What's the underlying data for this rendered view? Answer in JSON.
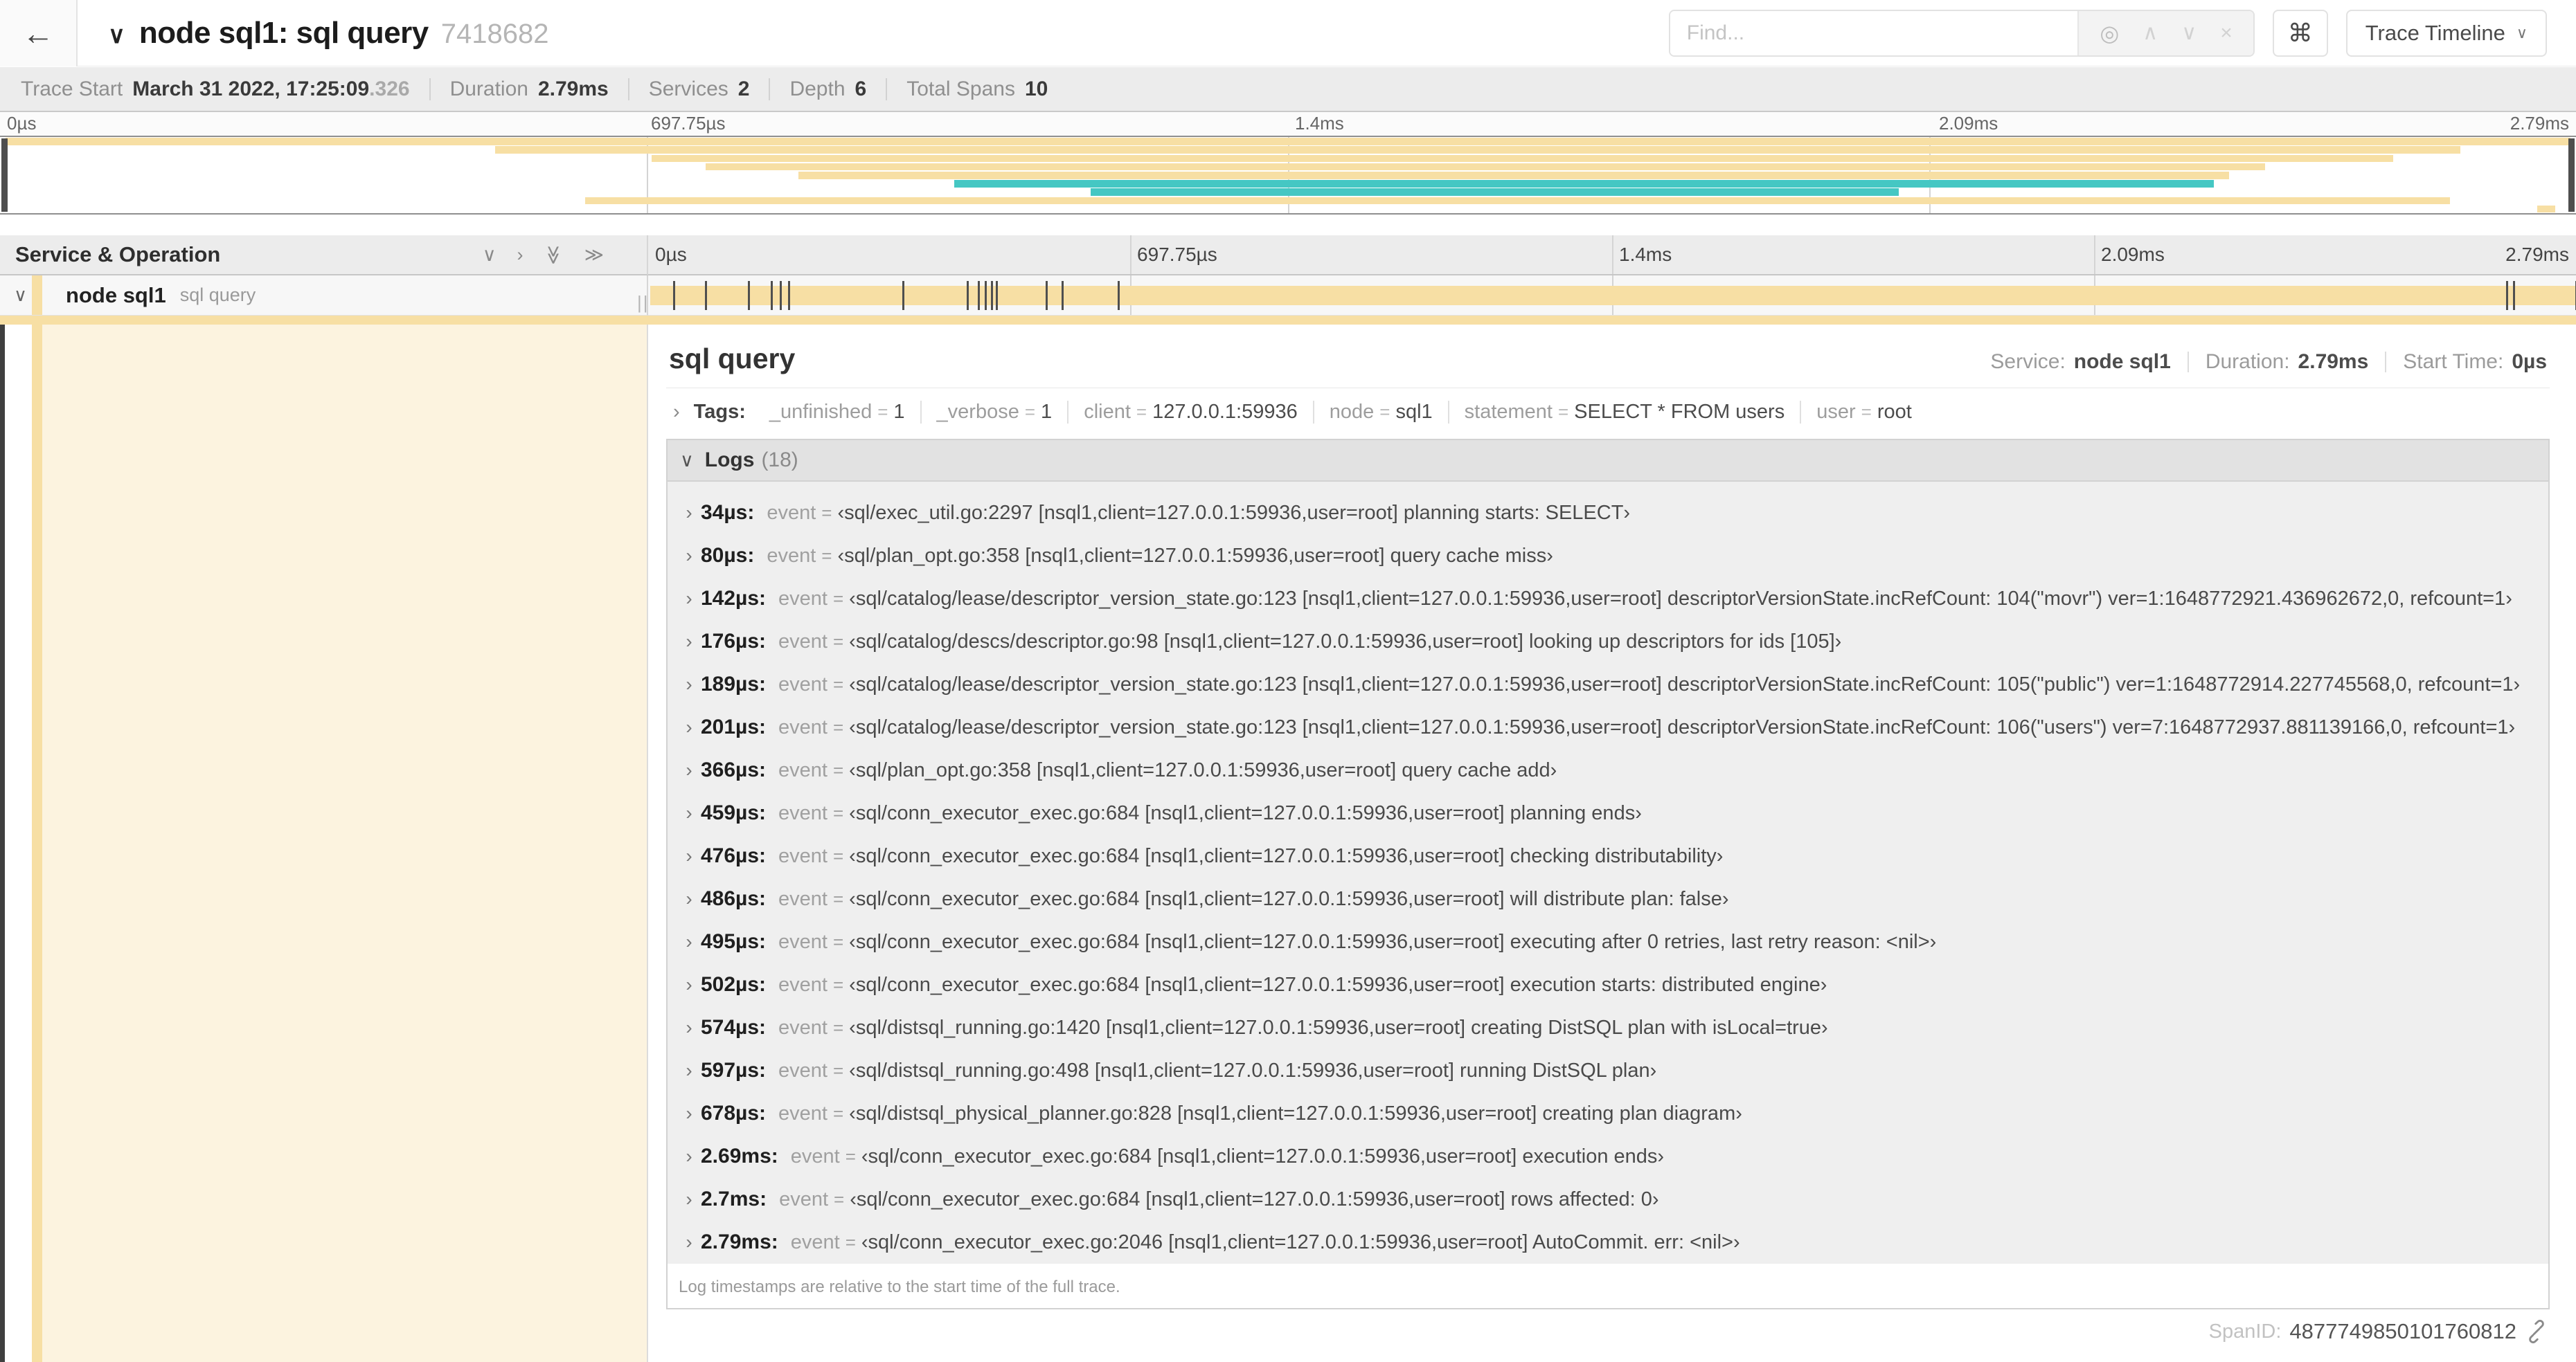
{
  "colors": {
    "span": "#F7DFA4",
    "span_light": "#FCF3DF",
    "teal": "#45C7C3"
  },
  "icons": {
    "back": "←",
    "chevron_down": "∨",
    "chevron_right": "›",
    "double_chevron": "≫",
    "find_target": "◎",
    "find_up": "∧",
    "find_down": "∨",
    "find_close": "×",
    "command": "⌘",
    "resizer": "||"
  },
  "header": {
    "title": "node sql1: sql query",
    "trace_id": "7418682",
    "find_placeholder": "Find...",
    "view_selector": "Trace Timeline"
  },
  "stats": {
    "trace_start_label": "Trace Start",
    "trace_start_value": "March 31 2022, 17:25:09",
    "trace_start_fraction": ".326",
    "duration_label": "Duration",
    "duration_value": "2.79ms",
    "services_label": "Services",
    "services_value": "2",
    "depth_label": "Depth",
    "depth_value": "6",
    "spans_label": "Total Spans",
    "spans_value": "10"
  },
  "timeline": {
    "total_us": 2790,
    "ruler_labels": [
      {
        "text": "0µs",
        "pct": 0
      },
      {
        "text": "697.75µs",
        "pct": 25
      },
      {
        "text": "1.4ms",
        "pct": 50
      },
      {
        "text": "2.09ms",
        "pct": 75
      },
      {
        "text": "2.79ms",
        "pct": 100
      }
    ]
  },
  "minimap": {
    "rows": [
      {
        "s": 0,
        "e": 100,
        "c": "span"
      },
      {
        "s": 19.1,
        "e": 95.7,
        "c": "span"
      },
      {
        "s": 25.2,
        "e": 93.1,
        "c": "span"
      },
      {
        "s": 27.3,
        "e": 88.1,
        "c": "span"
      },
      {
        "s": 30.9,
        "e": 86.7,
        "c": "span"
      },
      {
        "s": 37.0,
        "e": 86.1,
        "c": "teal"
      },
      {
        "s": 42.3,
        "e": 73.8,
        "c": "teal"
      },
      {
        "s": 22.6,
        "e": 95.3,
        "c": "span"
      },
      {
        "s": 98.7,
        "e": 99.4,
        "c": "span"
      }
    ]
  },
  "span_table": {
    "header": "Service & Operation",
    "row": {
      "service": "node sql1",
      "operation": "sql query"
    },
    "tick_times_us": [
      34,
      80,
      142,
      176,
      189,
      201,
      366,
      459,
      476,
      486,
      495,
      502,
      574,
      597,
      678,
      2690,
      2700,
      2790
    ]
  },
  "detail": {
    "title": "sql query",
    "service_label": "Service:",
    "service_value": "node sql1",
    "duration_label": "Duration:",
    "duration_value": "2.79ms",
    "start_label": "Start Time:",
    "start_value": "0µs",
    "tags": {
      "label": "Tags:",
      "eq": "=",
      "items": [
        {
          "key": "_unfinished",
          "value": "1"
        },
        {
          "key": "_verbose",
          "value": "1"
        },
        {
          "key": "client",
          "value": "127.0.0.1:59936"
        },
        {
          "key": "node",
          "value": "sql1"
        },
        {
          "key": "statement",
          "value": "SELECT * FROM users"
        },
        {
          "key": "user",
          "value": "root"
        }
      ]
    },
    "logs": {
      "label": "Logs",
      "count_display": "(18)",
      "event_key": "event",
      "eq": "=",
      "entries": [
        {
          "time": "34µs:",
          "value": "‹sql/exec_util.go:2297 [nsql1,client=127.0.0.1:59936,user=root] planning starts: SELECT›"
        },
        {
          "time": "80µs:",
          "value": "‹sql/plan_opt.go:358 [nsql1,client=127.0.0.1:59936,user=root] query cache miss›"
        },
        {
          "time": "142µs:",
          "value": "‹sql/catalog/lease/descriptor_version_state.go:123 [nsql1,client=127.0.0.1:59936,user=root] descriptorVersionState.incRefCount: 104(\"movr\") ver=1:1648772921.436962672,0, refcount=1›"
        },
        {
          "time": "176µs:",
          "value": "‹sql/catalog/descs/descriptor.go:98 [nsql1,client=127.0.0.1:59936,user=root] looking up descriptors for ids [105]›"
        },
        {
          "time": "189µs:",
          "value": "‹sql/catalog/lease/descriptor_version_state.go:123 [nsql1,client=127.0.0.1:59936,user=root] descriptorVersionState.incRefCount: 105(\"public\") ver=1:1648772914.227745568,0, refcount=1›"
        },
        {
          "time": "201µs:",
          "value": "‹sql/catalog/lease/descriptor_version_state.go:123 [nsql1,client=127.0.0.1:59936,user=root] descriptorVersionState.incRefCount: 106(\"users\") ver=7:1648772937.881139166,0, refcount=1›"
        },
        {
          "time": "366µs:",
          "value": "‹sql/plan_opt.go:358 [nsql1,client=127.0.0.1:59936,user=root] query cache add›"
        },
        {
          "time": "459µs:",
          "value": "‹sql/conn_executor_exec.go:684 [nsql1,client=127.0.0.1:59936,user=root] planning ends›"
        },
        {
          "time": "476µs:",
          "value": "‹sql/conn_executor_exec.go:684 [nsql1,client=127.0.0.1:59936,user=root] checking distributability›"
        },
        {
          "time": "486µs:",
          "value": "‹sql/conn_executor_exec.go:684 [nsql1,client=127.0.0.1:59936,user=root] will distribute plan: false›"
        },
        {
          "time": "495µs:",
          "value": "‹sql/conn_executor_exec.go:684 [nsql1,client=127.0.0.1:59936,user=root] executing after 0 retries, last retry reason: <nil>›"
        },
        {
          "time": "502µs:",
          "value": "‹sql/conn_executor_exec.go:684 [nsql1,client=127.0.0.1:59936,user=root] execution starts: distributed engine›"
        },
        {
          "time": "574µs:",
          "value": "‹sql/distsql_running.go:1420 [nsql1,client=127.0.0.1:59936,user=root] creating DistSQL plan with isLocal=true›"
        },
        {
          "time": "597µs:",
          "value": "‹sql/distsql_running.go:498 [nsql1,client=127.0.0.1:59936,user=root] running DistSQL plan›"
        },
        {
          "time": "678µs:",
          "value": "‹sql/distsql_physical_planner.go:828 [nsql1,client=127.0.0.1:59936,user=root] creating plan diagram›"
        },
        {
          "time": "2.69ms:",
          "value": "‹sql/conn_executor_exec.go:684 [nsql1,client=127.0.0.1:59936,user=root] execution ends›"
        },
        {
          "time": "2.7ms:",
          "value": "‹sql/conn_executor_exec.go:684 [nsql1,client=127.0.0.1:59936,user=root] rows affected: 0›"
        },
        {
          "time": "2.79ms:",
          "value": "‹sql/conn_executor_exec.go:2046 [nsql1,client=127.0.0.1:59936,user=root] AutoCommit. err: <nil>›"
        }
      ],
      "footer": "Log timestamps are relative to the start time of the full trace."
    },
    "span_id_label": "SpanID:",
    "span_id_value": "4877749850101760812"
  }
}
